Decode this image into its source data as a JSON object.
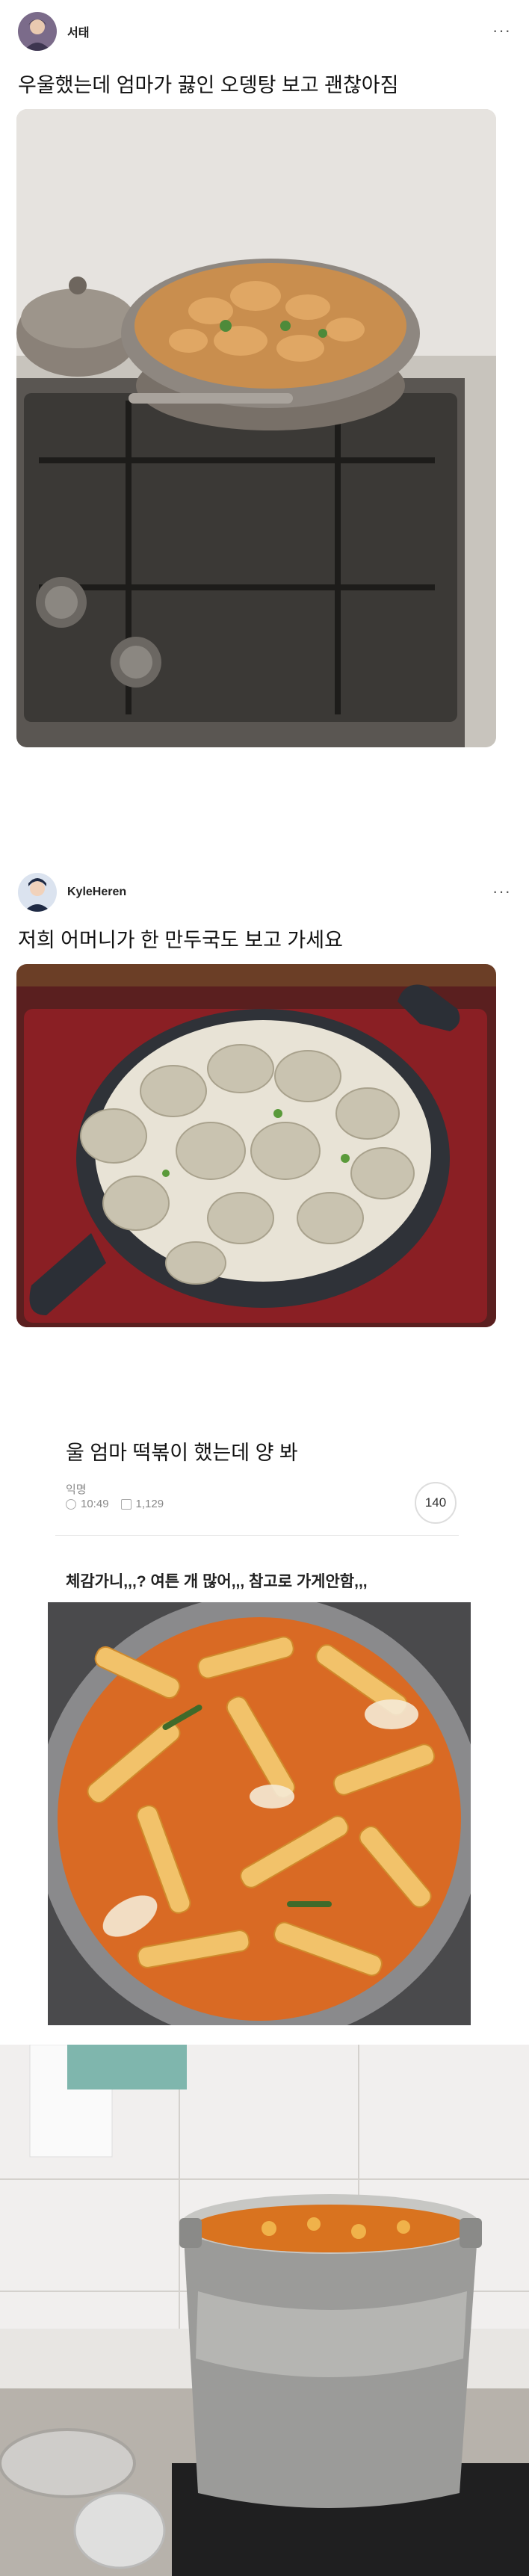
{
  "posts": [
    {
      "author": "서태",
      "text": "우울했는데 엄마가 끓인 오뎅탕 보고 괜찮아짐",
      "more": "···"
    },
    {
      "author": "KyleHeren",
      "text": "저희 어머니가 한 만두국도 보고 가세요",
      "more": "···"
    }
  ],
  "community": {
    "title": "울 엄마 떡볶이 했는데 양 봐",
    "author": "익명",
    "time": "10:49",
    "views": "1,129",
    "comments": "140",
    "body": "체감가니,,,? 여튼 개 많어,,, 참고로 가게안함,,,"
  },
  "colors": {
    "text": "#111111",
    "meta": "#888888",
    "divider": "#e6e6e6"
  }
}
